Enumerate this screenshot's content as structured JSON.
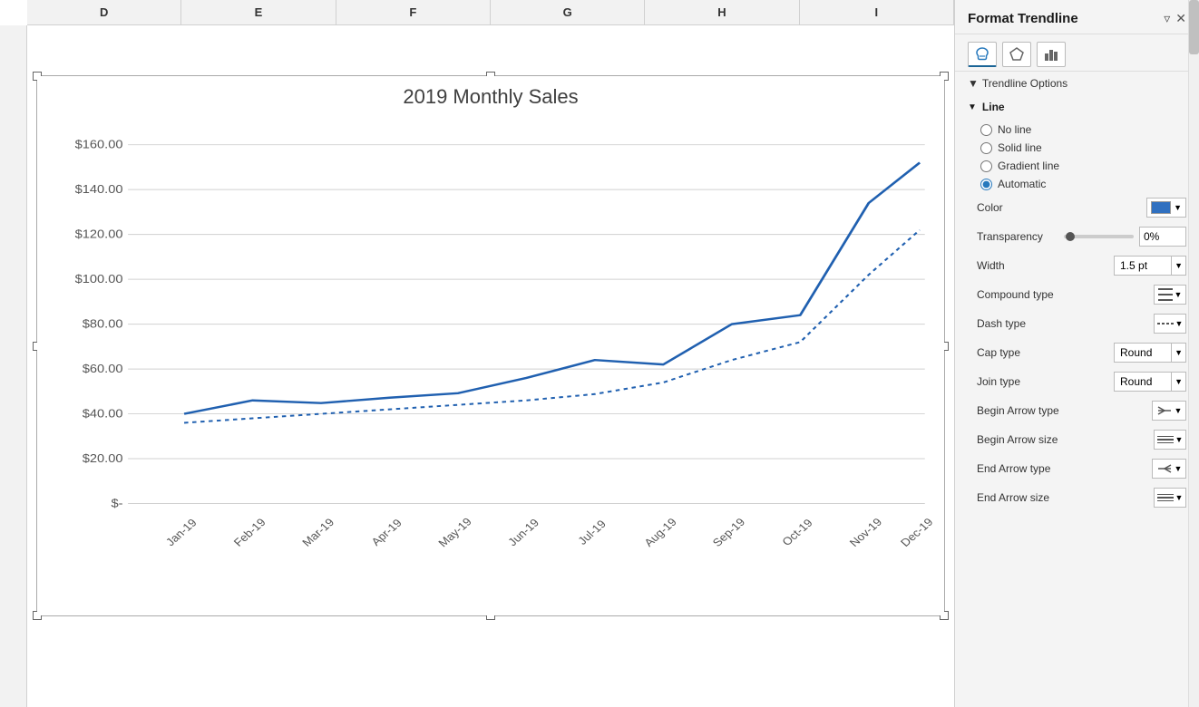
{
  "spreadsheet": {
    "columns": [
      "D",
      "E",
      "F",
      "G",
      "H",
      "I"
    ]
  },
  "chart": {
    "title": "2019 Monthly Sales",
    "yAxis": {
      "labels": [
        "$160.00",
        "$140.00",
        "$120.00",
        "$100.00",
        "$80.00",
        "$60.00",
        "$40.00",
        "$20.00",
        "$-"
      ]
    },
    "xAxis": {
      "labels": [
        "Jan-19",
        "Feb-19",
        "Mar-19",
        "Apr-19",
        "May-19",
        "Jun-19",
        "Jul-19",
        "Aug-19",
        "Sep-19",
        "Oct-19",
        "Nov-19",
        "Dec-19"
      ]
    }
  },
  "panel": {
    "title": "Format Trendline",
    "options_label": "Trendline Options",
    "sections": {
      "line": {
        "label": "Line",
        "no_line": "No line",
        "solid_line": "Solid line",
        "gradient_line": "Gradient line",
        "automatic": "Automatic"
      },
      "color_label": "Color",
      "transparency_label": "Transparency",
      "transparency_value": "0%",
      "width_label": "Width",
      "width_value": "1.5 pt",
      "compound_label": "Compound type",
      "dash_label": "Dash type",
      "cap_label": "Cap type",
      "cap_value": "Round",
      "join_label": "Join type",
      "join_value": "Round",
      "begin_arrow_label": "Begin Arrow type",
      "begin_arrow_size_label": "Begin Arrow size",
      "end_arrow_label": "End Arrow type",
      "end_arrow_size_label": "End Arrow size"
    }
  }
}
